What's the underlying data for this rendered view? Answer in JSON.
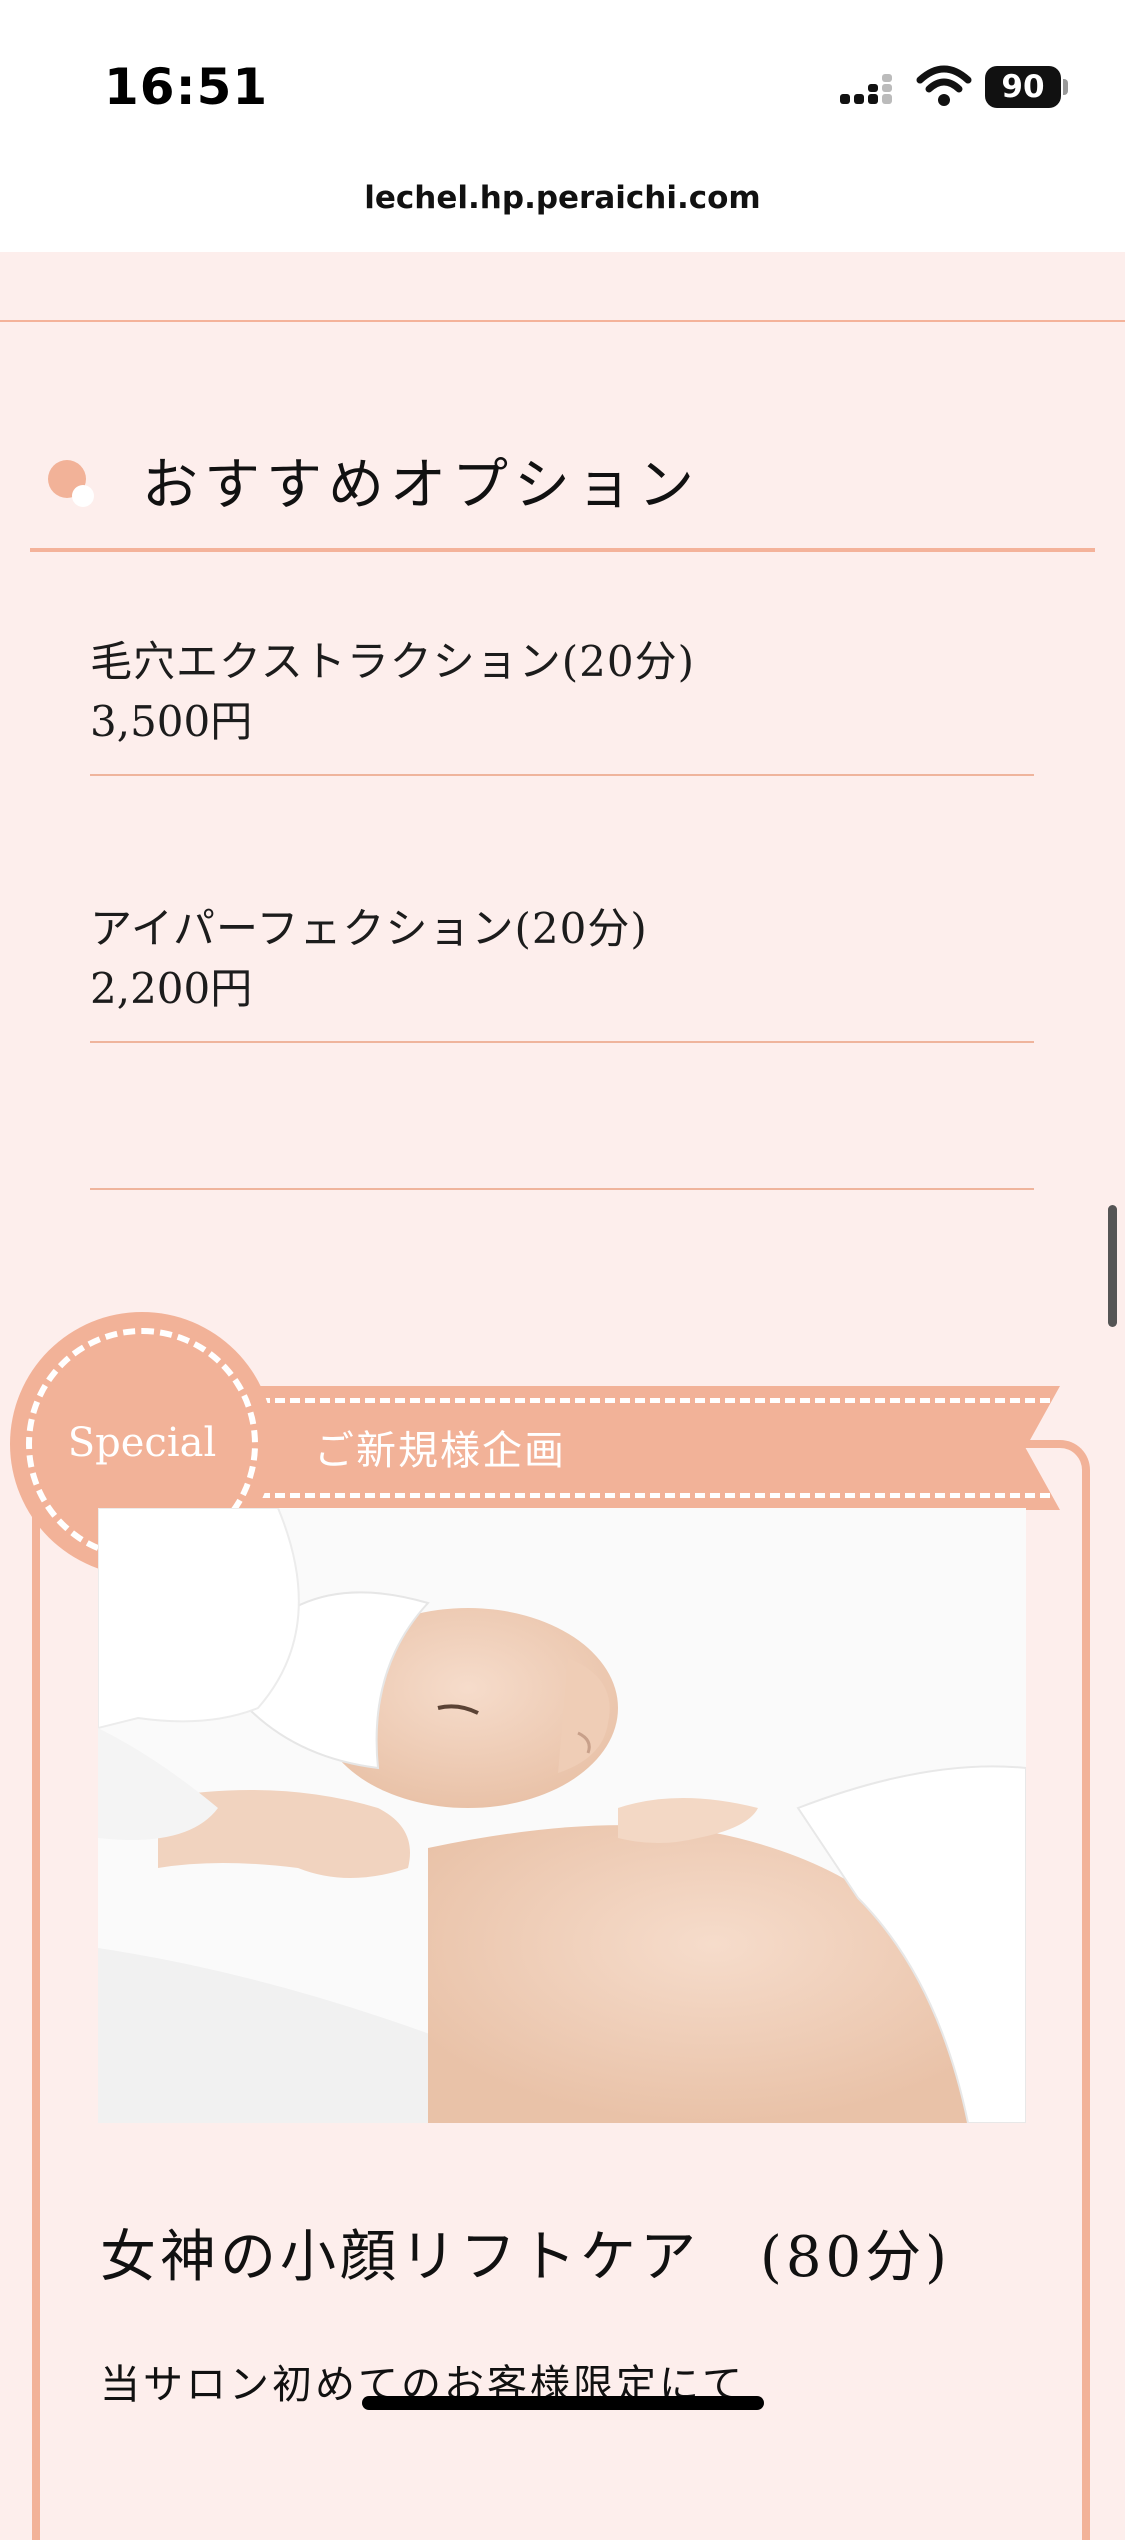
{
  "status_bar": {
    "time": "16:51",
    "battery": "90",
    "icons": [
      "signal-icon",
      "wifi-icon",
      "battery-icon"
    ]
  },
  "browser": {
    "url": "lechel.hp.peraichi.com"
  },
  "options_section": {
    "heading": "おすすめオプション",
    "items": [
      {
        "name": "毛穴エクストラクション(20分)",
        "price": "3,500円"
      },
      {
        "name": "アイパーフェクション(20分)",
        "price": "2,200円"
      }
    ]
  },
  "special_section": {
    "badge": "Special",
    "banner": "ご新規様企画",
    "photo_icon": "facial-massage-photo",
    "title": "女神の小顔リフトケア　(80分)",
    "description": "当サロン初めてのお客様限定にて"
  },
  "colors": {
    "background": "#fdeeec",
    "accent": "#f2b298",
    "text": "#1c1c1c"
  }
}
